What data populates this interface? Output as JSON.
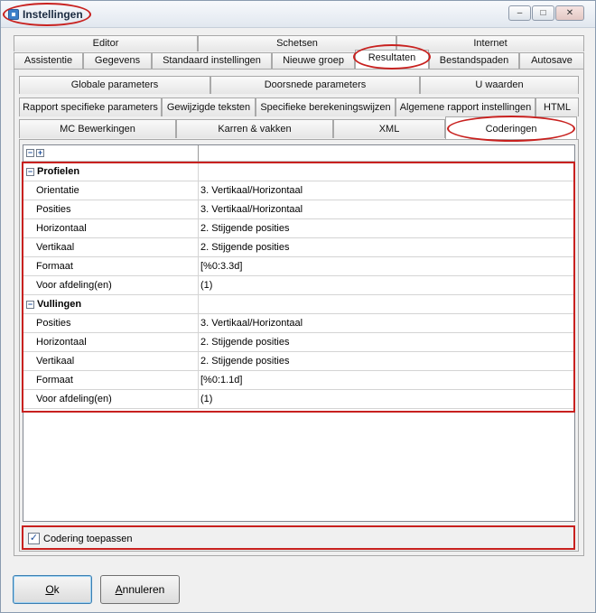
{
  "window": {
    "title": "Instellingen",
    "minimize": "–",
    "maximize": "□",
    "close": "✕"
  },
  "tabs_row1": [
    "Editor",
    "Schetsen",
    "Internet"
  ],
  "tabs_row2": [
    "Assistentie",
    "Gegevens",
    "Standaard instellingen",
    "Nieuwe groep",
    "Resultaten",
    "Bestandspaden",
    "Autosave"
  ],
  "subtabs_row1": [
    "Globale parameters",
    "Doorsnede parameters",
    "U waarden"
  ],
  "subtabs_row2": [
    "Rapport specifieke parameters",
    "Gewijzigde teksten",
    "Specifieke berekeningswijzen",
    "Algemene rapport instellingen",
    "HTML"
  ],
  "subtabs_row3": [
    "MC Bewerkingen",
    "Karren & vakken",
    "XML",
    "Coderingen"
  ],
  "grid": {
    "collapse_all": "−",
    "expand_all": "+",
    "profielen": {
      "title": "Profielen",
      "toggle": "−",
      "rows": [
        {
          "label": "Orientatie",
          "value": "3. Vertikaal/Horizontaal"
        },
        {
          "label": "Posities",
          "value": "3. Vertikaal/Horizontaal"
        },
        {
          "label": "Horizontaal",
          "value": "2. Stijgende posities"
        },
        {
          "label": "Vertikaal",
          "value": "2. Stijgende posities"
        },
        {
          "label": "Formaat",
          "value": "[%0:3.3d]"
        },
        {
          "label": "Voor afdeling(en)",
          "value": "(1)"
        }
      ]
    },
    "vullingen": {
      "title": "Vullingen",
      "toggle": "−",
      "rows": [
        {
          "label": "Posities",
          "value": "3. Vertikaal/Horizontaal"
        },
        {
          "label": "Horizontaal",
          "value": "2. Stijgende posities"
        },
        {
          "label": "Vertikaal",
          "value": "2. Stijgende posities"
        },
        {
          "label": "Formaat",
          "value": "[%0:1.1d]"
        },
        {
          "label": "Voor afdeling(en)",
          "value": "(1)"
        }
      ]
    }
  },
  "checkbox": {
    "label": "Codering toepassen",
    "checked": true,
    "mark": "✓"
  },
  "buttons": {
    "ok": {
      "accel": "O",
      "rest": "k"
    },
    "cancel": {
      "accel": "A",
      "rest": "nnuleren"
    }
  },
  "colors": {
    "highlight": "#c8211f",
    "accent": "#1e4f9c"
  }
}
